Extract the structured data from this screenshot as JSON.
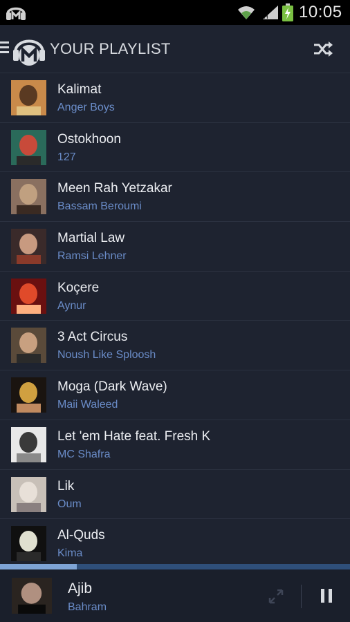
{
  "status_bar": {
    "time": "10:05"
  },
  "action_bar": {
    "title": "YOUR PLAYLIST",
    "menu_icon": "hamburger-icon",
    "logo_icon": "headphones-m-logo-icon",
    "shuffle_icon": "shuffle-icon"
  },
  "playlist": [
    {
      "song": "Kalimat",
      "artist": "Anger Boys",
      "colors": [
        "#c98a4a",
        "#5a3a22",
        "#e0c080"
      ]
    },
    {
      "song": "Ostokhoon",
      "artist": "127",
      "colors": [
        "#2a6a5a",
        "#c84a3a",
        "#2a2a2a"
      ]
    },
    {
      "song": "Meen Rah Yetzakar",
      "artist": "Bassam Beroumi",
      "colors": [
        "#8a7060",
        "#c0a080",
        "#3a2a22"
      ]
    },
    {
      "song": "Martial Law",
      "artist": "Ramsi Lehner",
      "colors": [
        "#3a2a2a",
        "#c89a80",
        "#8a3a2a"
      ]
    },
    {
      "song": "Koçere",
      "artist": "Aynur",
      "colors": [
        "#6a1010",
        "#e04a2a",
        "#ffb080"
      ]
    },
    {
      "song": "3 Act Circus",
      "artist": "Noush Like Sploosh",
      "colors": [
        "#5a4a3a",
        "#c8a080",
        "#2a2a2a"
      ]
    },
    {
      "song": "Moga (Dark Wave)",
      "artist": "Maii Waleed",
      "colors": [
        "#1a1410",
        "#d0a040",
        "#c08a60"
      ]
    },
    {
      "song": "Let 'em Hate feat. Fresh K",
      "artist": "MC Shafra",
      "colors": [
        "#e8e8e8",
        "#3a3a3a",
        "#8a8a8a"
      ]
    },
    {
      "song": "Lik",
      "artist": "Oum",
      "colors": [
        "#c8c0b8",
        "#e8e0d8",
        "#8a8080"
      ]
    },
    {
      "song": "Al-Quds",
      "artist": "Kima",
      "colors": [
        "#101010",
        "#e0e0d0",
        "#2a2a2a"
      ]
    }
  ],
  "player": {
    "progress": 0.22,
    "song": "Ajib",
    "artist": "Bahram",
    "expand_icon": "expand-icon",
    "pause_icon": "pause-icon",
    "colors": [
      "#2a2420",
      "#b09080",
      "#0a0a0a"
    ]
  }
}
